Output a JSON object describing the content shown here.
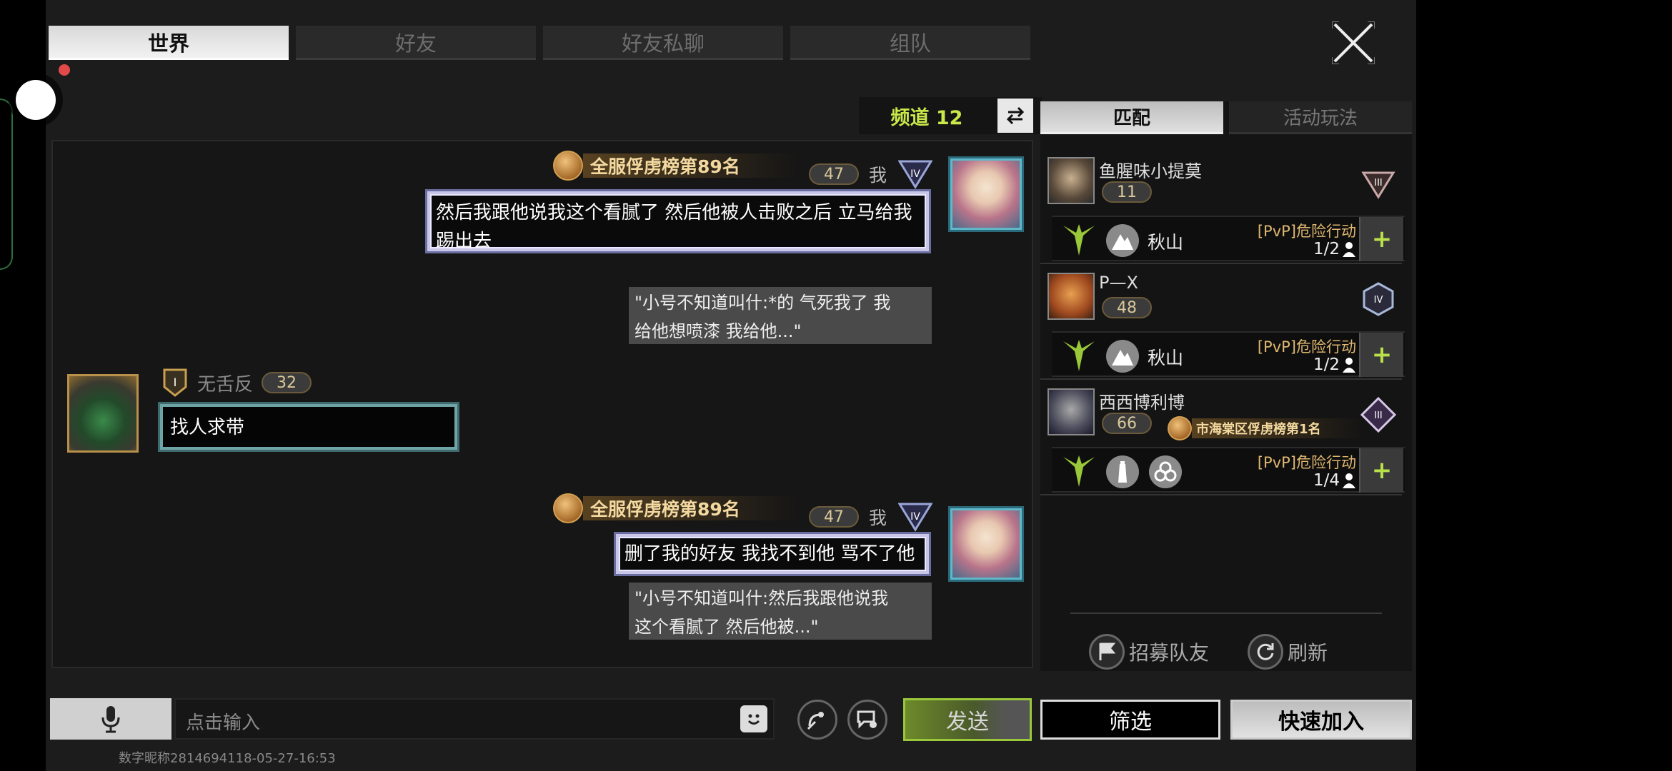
{
  "tabs": [
    {
      "label": "世界",
      "active": true
    },
    {
      "label": "好友",
      "active": false
    },
    {
      "label": "好友私聊",
      "active": false
    },
    {
      "label": "组队",
      "active": false
    }
  ],
  "channel": {
    "label": "频道 12"
  },
  "messages": {
    "m1": {
      "rank": "全服俘虏榜第89名",
      "level": "47",
      "me": "我",
      "text_line1": "然后我跟他说我这个看腻了 然后他被人击败之后 立马给我",
      "text_line2": "踢出去",
      "quote_line1": "\"小号不知道叫什:*的 气死我了 我",
      "quote_line2": "给他想喷漆 我给他...\""
    },
    "m2": {
      "name": "无舌反",
      "level": "32",
      "tier": "I",
      "text": "找人求带"
    },
    "m3": {
      "rank": "全服俘虏榜第89名",
      "level": "47",
      "me": "我",
      "text": "删了我的好友 我找不到他 骂不了他",
      "quote_line1": "\"小号不知道叫什:然后我跟他说我",
      "quote_line2": "这个看腻了 然后他被...\""
    }
  },
  "right_panel": {
    "tabs": [
      {
        "label": "匹配",
        "active": true
      },
      {
        "label": "活动玩法",
        "active": false
      }
    ],
    "teams": [
      {
        "name": "鱼腥味小提莫",
        "level": "11",
        "tier": "III",
        "map": "秋山",
        "mode": "[PvP]危险行动",
        "count": "1/2"
      },
      {
        "name": "P—X",
        "level": "48",
        "tier": "IV",
        "map": "秋山",
        "mode": "[PvP]危险行动",
        "count": "1/2"
      },
      {
        "name": "西西博利博",
        "level": "66",
        "tier": "III",
        "badge": "市海棠区俘虏榜第1名",
        "mode": "[PvP]危险行动",
        "count": "1/4"
      }
    ],
    "recruit_label": "招募队友",
    "refresh_label": "刷新"
  },
  "input": {
    "placeholder": "点击输入"
  },
  "buttons": {
    "send": "发送",
    "filter": "筛选",
    "quick_join": "快速加入"
  },
  "footer": "数字昵称2814694118-05-27-16:53",
  "colors": {
    "accent_green": "#9ac83a",
    "gold": "#e0b870",
    "channel": "#c9e84a"
  }
}
